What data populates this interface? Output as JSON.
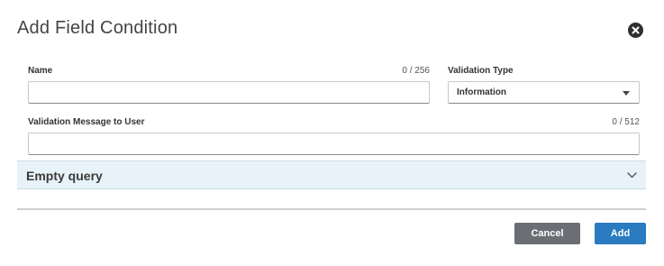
{
  "dialog": {
    "title": "Add Field Condition"
  },
  "form": {
    "name": {
      "label": "Name",
      "counter": "0 / 256",
      "value": ""
    },
    "validation_type": {
      "label": "Validation Type",
      "selected": "Information"
    },
    "message": {
      "label": "Validation Message to User",
      "counter": "0 / 512",
      "value": ""
    }
  },
  "query": {
    "label": "Empty query"
  },
  "actions": {
    "cancel_label": "Cancel",
    "add_label": "Add",
    "add_color": "#2a7bbf",
    "cancel_color": "#6b6f74"
  },
  "icons": {
    "close": "close-circle-icon",
    "caret": "caret-down-icon",
    "chevron": "chevron-down-icon"
  }
}
